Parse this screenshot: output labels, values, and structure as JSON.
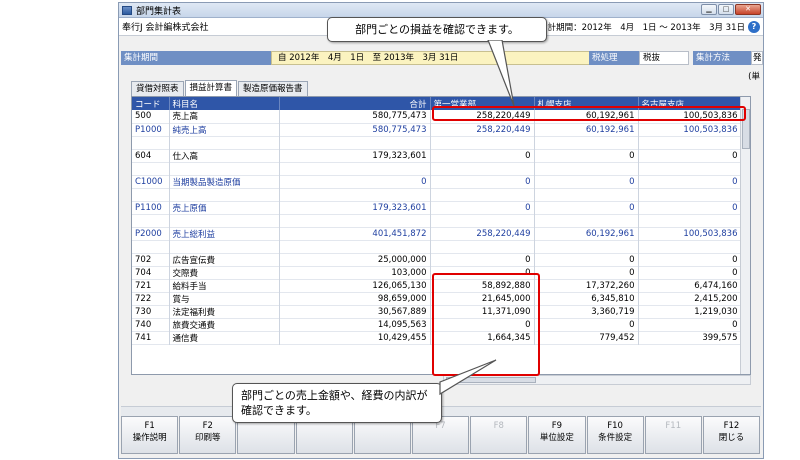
{
  "window": {
    "title": "部門集計表",
    "company": "奉行J 会計編株式会社",
    "period_info": "会計期間：2012年　4月　1日 ～ 2013年　3月 31日"
  },
  "filter": {
    "period_label": "集計期間",
    "period_value": "自 2012年　4月　1日　至 2013年　3月 31日",
    "tax_label": "税処理",
    "tax_value": "税抜",
    "method_label": "集計方法",
    "method_value": "発",
    "unit": "(単"
  },
  "tabs": [
    "貸借対照表",
    "損益計算書",
    "製造原価報告書"
  ],
  "active_tab": 1,
  "table": {
    "headers": [
      "コード",
      "科目名",
      "合計",
      "第一営業部",
      "札幌支店",
      "名古屋支店"
    ],
    "rows": [
      {
        "code": "500",
        "name": "売上高",
        "total": "580,775,473",
        "d1": "258,220,449",
        "d2": "60,192,961",
        "d3": "100,503,836",
        "type": "normal"
      },
      {
        "code": "P1000",
        "name": "純売上高",
        "total": "580,775,473",
        "d1": "258,220,449",
        "d2": "60,192,961",
        "d3": "100,503,836",
        "type": "sub"
      },
      {
        "code": "",
        "name": "",
        "total": "",
        "d1": "",
        "d2": "",
        "d3": "",
        "type": "gap"
      },
      {
        "code": "604",
        "name": "仕入高",
        "total": "179,323,601",
        "d1": "0",
        "d2": "0",
        "d3": "0",
        "type": "normal"
      },
      {
        "code": "",
        "name": "",
        "total": "",
        "d1": "",
        "d2": "",
        "d3": "",
        "type": "gap"
      },
      {
        "code": "C1000",
        "name": "当期製品製造原価",
        "total": "0",
        "d1": "0",
        "d2": "0",
        "d3": "0",
        "type": "sub"
      },
      {
        "code": "",
        "name": "",
        "total": "",
        "d1": "",
        "d2": "",
        "d3": "",
        "type": "gap"
      },
      {
        "code": "P1100",
        "name": "売上原価",
        "total": "179,323,601",
        "d1": "0",
        "d2": "0",
        "d3": "0",
        "type": "sub"
      },
      {
        "code": "",
        "name": "",
        "total": "",
        "d1": "",
        "d2": "",
        "d3": "",
        "type": "gap"
      },
      {
        "code": "P2000",
        "name": "売上総利益",
        "total": "401,451,872",
        "d1": "258,220,449",
        "d2": "60,192,961",
        "d3": "100,503,836",
        "type": "sub"
      },
      {
        "code": "",
        "name": "",
        "total": "",
        "d1": "",
        "d2": "",
        "d3": "",
        "type": "gap"
      },
      {
        "code": "702",
        "name": "広告宣伝費",
        "total": "25,000,000",
        "d1": "0",
        "d2": "0",
        "d3": "0",
        "type": "normal"
      },
      {
        "code": "704",
        "name": "交際費",
        "total": "103,000",
        "d1": "0",
        "d2": "0",
        "d3": "0",
        "type": "normal"
      },
      {
        "code": "721",
        "name": "給料手当",
        "total": "126,065,130",
        "d1": "58,892,880",
        "d2": "17,372,260",
        "d3": "6,474,160",
        "type": "normal"
      },
      {
        "code": "722",
        "name": "賞与",
        "total": "98,659,000",
        "d1": "21,645,000",
        "d2": "6,345,810",
        "d3": "2,415,200",
        "type": "normal"
      },
      {
        "code": "730",
        "name": "法定福利費",
        "total": "30,567,889",
        "d1": "11,371,090",
        "d2": "3,360,719",
        "d3": "1,219,030",
        "type": "normal"
      },
      {
        "code": "740",
        "name": "旅費交通費",
        "total": "14,095,563",
        "d1": "0",
        "d2": "0",
        "d3": "0",
        "type": "normal"
      },
      {
        "code": "741",
        "name": "通信費",
        "total": "10,429,455",
        "d1": "1,664,345",
        "d2": "779,452",
        "d3": "399,575",
        "type": "normal"
      }
    ]
  },
  "fkeys": [
    {
      "key": "F1",
      "label": "操作説明",
      "enabled": true
    },
    {
      "key": "F2",
      "label": "印刷等",
      "enabled": true
    },
    {
      "key": "",
      "label": "",
      "enabled": false
    },
    {
      "key": "",
      "label": "",
      "enabled": false
    },
    {
      "key": "",
      "label": "",
      "enabled": false
    },
    {
      "key": "F7",
      "label": "",
      "enabled": false
    },
    {
      "key": "F8",
      "label": "",
      "enabled": false
    },
    {
      "key": "F9",
      "label": "単位設定",
      "enabled": true
    },
    {
      "key": "F10",
      "label": "条件設定",
      "enabled": true
    },
    {
      "key": "F11",
      "label": "",
      "enabled": false
    },
    {
      "key": "F12",
      "label": "閉じる",
      "enabled": true
    }
  ],
  "callouts": {
    "top": "部門ごとの損益を確認できます。",
    "bottom": "部門ごとの売上金額や、経費の内訳が確認できます。"
  },
  "colors": {
    "header": "#2f56a8",
    "highlight": "#e00000",
    "subtotal_text": "#1f3fa0"
  }
}
